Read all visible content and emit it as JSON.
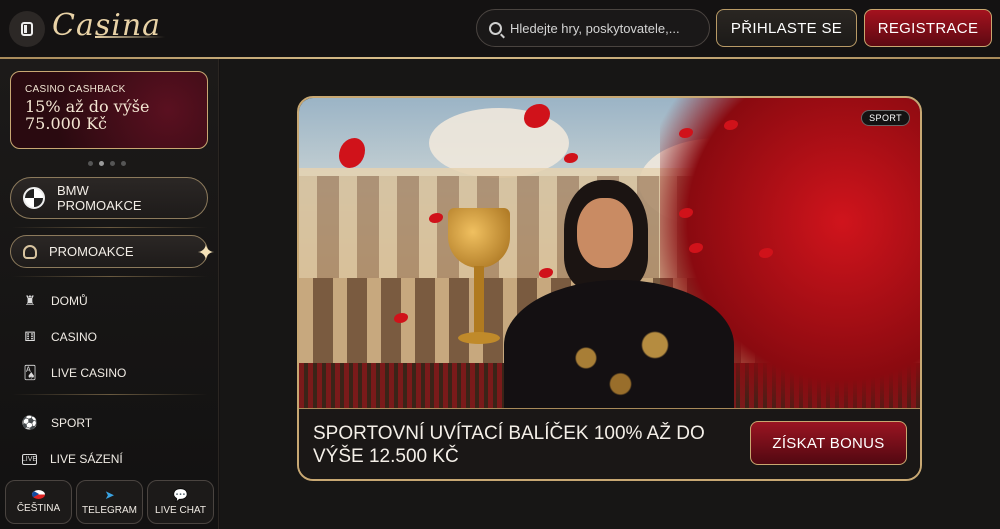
{
  "header": {
    "logo": "Casina",
    "search_placeholder": "Hledejte hry, poskytovatele,...",
    "login_label": "PŘIHLASTE SE",
    "register_label": "REGISTRACE"
  },
  "sidebar": {
    "cashback": {
      "kicker": "CASINO CASHBACK",
      "title": "15% až do výše 75.000 Kč"
    },
    "bmw_label": "BMW PROMOAKCE",
    "promo_label": "PROMOAKCE",
    "nav": [
      {
        "label": "DOMŮ",
        "icon": "castle-icon"
      },
      {
        "label": "CASINO",
        "icon": "dice-icon"
      },
      {
        "label": "LIVE CASINO",
        "icon": "cards-icon"
      },
      {
        "label": "SPORT",
        "icon": "soccer-ball-icon"
      },
      {
        "label": "LIVE SÁZENÍ",
        "icon": "live-icon"
      }
    ],
    "footer": [
      {
        "label": "ČEŠTINA",
        "icon": "czech-flag-icon"
      },
      {
        "label": "TELEGRAM",
        "icon": "telegram-icon"
      },
      {
        "label": "LIVE CHAT",
        "icon": "chat-icon"
      }
    ]
  },
  "banner": {
    "tag": "SPORT",
    "text": "SPORTOVNÍ UVÍTACÍ BALÍČEK 100% AŽ DO VÝŠE 12.500 KČ",
    "button": "ZÍSKAT BONUS"
  },
  "colors": {
    "accent_gold": "#c8a873",
    "accent_red": "#a4121e"
  }
}
